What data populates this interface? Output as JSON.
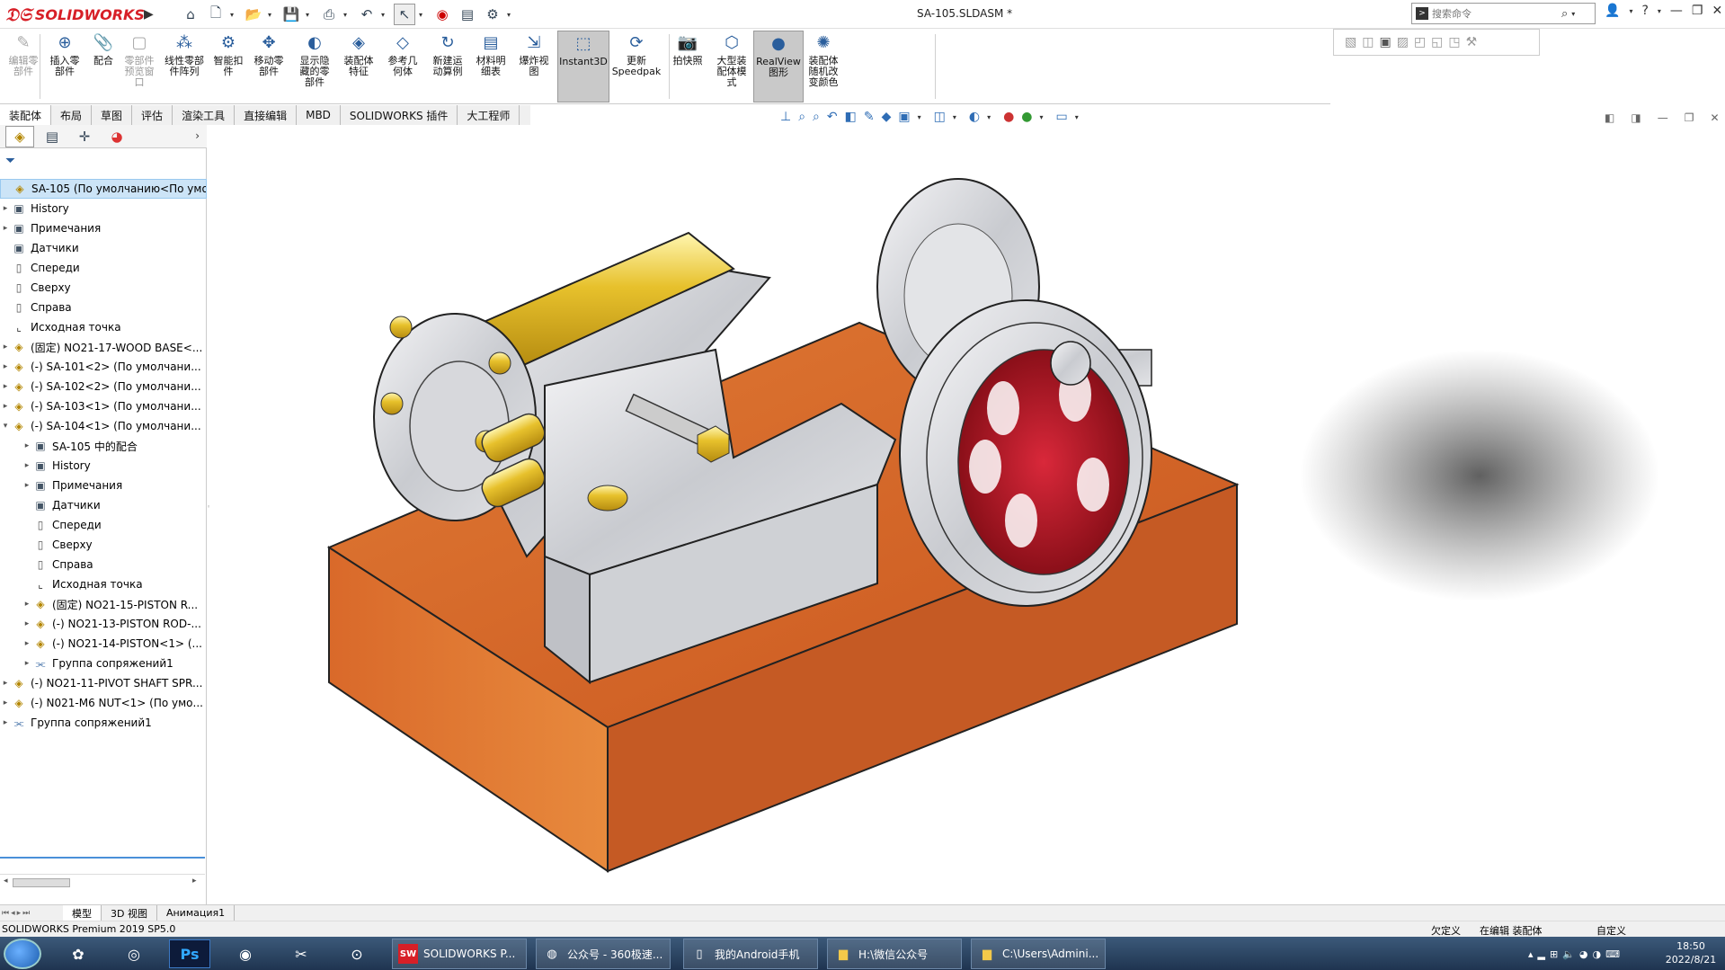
{
  "app": {
    "logo_text": "SOLIDWORKS",
    "doc_title": "SA-105.SLDASM *"
  },
  "search": {
    "placeholder": "搜索命令"
  },
  "ribbon": {
    "buttons": [
      {
        "label": "编辑零\n部件",
        "icon": "edit-component-icon",
        "disabled": true
      },
      {
        "label": "插入零\n部件",
        "icon": "insert-component-icon"
      },
      {
        "label": "配合",
        "icon": "mate-icon"
      },
      {
        "label": "零部件\n预览窗\n口",
        "icon": "component-preview-icon",
        "disabled": true
      },
      {
        "label": "线性零部\n件阵列",
        "icon": "linear-pattern-icon"
      },
      {
        "label": "智能扣\n件",
        "icon": "smart-fasteners-icon"
      },
      {
        "label": "移动零\n部件",
        "icon": "move-component-icon"
      },
      {
        "label": "显示隐\n藏的零\n部件",
        "icon": "show-hidden-icon"
      },
      {
        "label": "装配体\n特征",
        "icon": "assembly-features-icon"
      },
      {
        "label": "参考几\n何体",
        "icon": "reference-geometry-icon"
      },
      {
        "label": "新建运\n动算例",
        "icon": "new-motion-study-icon"
      },
      {
        "label": "材料明\n细表",
        "icon": "bill-of-materials-icon"
      },
      {
        "label": "爆炸视\n图",
        "icon": "exploded-view-icon"
      },
      {
        "label": "Instant3D",
        "icon": "instant3d-icon",
        "active": true
      },
      {
        "label": "更新\nSpeedpak",
        "icon": "speedpak-icon"
      },
      {
        "label": "拍快照",
        "icon": "snapshot-icon"
      },
      {
        "label": "大型装\n配体模\n式",
        "icon": "large-assembly-icon"
      },
      {
        "label": "RealView\n图形",
        "icon": "realview-icon",
        "active": true
      },
      {
        "label": "装配体\n随机改\n变颜色",
        "icon": "random-color-icon"
      }
    ]
  },
  "tabs": [
    "装配体",
    "布局",
    "草图",
    "评估",
    "渲染工具",
    "直接编辑",
    "MBD",
    "SOLIDWORKS 插件",
    "大工程师"
  ],
  "tree": {
    "rows": [
      {
        "label": "SA-105  (По умолчанию<По умо...",
        "icon": "asm",
        "indent": 0,
        "exp": "",
        "sel": true
      },
      {
        "label": "History",
        "icon": "folder",
        "indent": 0,
        "exp": "▸"
      },
      {
        "label": "Примечания",
        "icon": "folder",
        "indent": 0,
        "exp": "▸"
      },
      {
        "label": "Датчики",
        "icon": "folder",
        "indent": 0,
        "exp": ""
      },
      {
        "label": "Спереди",
        "icon": "plane",
        "indent": 0,
        "exp": ""
      },
      {
        "label": "Сверху",
        "icon": "plane",
        "indent": 0,
        "exp": ""
      },
      {
        "label": "Справа",
        "icon": "plane",
        "indent": 0,
        "exp": ""
      },
      {
        "label": "Исходная точка",
        "icon": "origin",
        "indent": 0,
        "exp": ""
      },
      {
        "label": "(固定) NO21-17-WOOD BASE<...",
        "icon": "asm",
        "indent": 0,
        "exp": "▸"
      },
      {
        "label": "(-) SA-101<2> (По умолчани...",
        "icon": "asm",
        "indent": 0,
        "exp": "▸"
      },
      {
        "label": "(-) SA-102<2> (По умолчани...",
        "icon": "asm",
        "indent": 0,
        "exp": "▸"
      },
      {
        "label": "(-) SA-103<1> (По умолчани...",
        "icon": "asm",
        "indent": 0,
        "exp": "▸"
      },
      {
        "label": "(-) SA-104<1> (По умолчани...",
        "icon": "asm",
        "indent": 0,
        "exp": "▾"
      },
      {
        "label": "SA-105 中的配合",
        "icon": "folder",
        "indent": 1,
        "exp": "▸"
      },
      {
        "label": "History",
        "icon": "folder",
        "indent": 1,
        "exp": "▸"
      },
      {
        "label": "Примечания",
        "icon": "folder",
        "indent": 1,
        "exp": "▸"
      },
      {
        "label": "Датчики",
        "icon": "folder",
        "indent": 1,
        "exp": ""
      },
      {
        "label": "Спереди",
        "icon": "plane",
        "indent": 1,
        "exp": ""
      },
      {
        "label": "Сверху",
        "icon": "plane",
        "indent": 1,
        "exp": ""
      },
      {
        "label": "Справа",
        "icon": "plane",
        "indent": 1,
        "exp": ""
      },
      {
        "label": "Исходная точка",
        "icon": "origin",
        "indent": 1,
        "exp": ""
      },
      {
        "label": "(固定) NO21-15-PISTON R...",
        "icon": "asm",
        "indent": 1,
        "exp": "▸"
      },
      {
        "label": "(-) NO21-13-PISTON ROD-...",
        "icon": "asm",
        "indent": 1,
        "exp": "▸"
      },
      {
        "label": "(-) NO21-14-PISTON<1> (...",
        "icon": "asm",
        "indent": 1,
        "exp": "▸"
      },
      {
        "label": "Группа сопряжений1",
        "icon": "mate",
        "indent": 1,
        "exp": "▸"
      },
      {
        "label": "(-) NO21-11-PIVOT SHAFT SPR...",
        "icon": "asm",
        "indent": 0,
        "exp": "▸"
      },
      {
        "label": "(-) N021-M6 NUT<1> (По умо...",
        "icon": "asm",
        "indent": 0,
        "exp": "▸"
      },
      {
        "label": "Группа сопряжений1",
        "icon": "mate",
        "indent": 0,
        "exp": "▸"
      }
    ]
  },
  "bottom_tabs": [
    "模型",
    "3D 视图",
    "Анимация1"
  ],
  "status": {
    "app": "SOLIDWORKS Premium 2019 SP5.0",
    "undefined": "欠定义",
    "editing": "在编辑 装配体",
    "custom": "自定义"
  },
  "taskbar": {
    "tasks": [
      {
        "label": "SOLIDWORKS P...",
        "icon": "solidworks-icon"
      },
      {
        "label": "公众号 - 360极速...",
        "icon": "browser-icon"
      },
      {
        "label": "我的Android手机",
        "icon": "phone-icon"
      },
      {
        "label": "H:\\微信公众号",
        "icon": "folder-icon"
      },
      {
        "label": "C:\\Users\\Admini...",
        "icon": "folder-icon"
      }
    ],
    "time": "18:50",
    "date": "2022/8/21"
  },
  "colors": {
    "brand": "#d71f27",
    "selection": "#cce4f7",
    "wood": "#d3652a",
    "brass": "#e8c22e",
    "flywheel_inner": "#a51020"
  }
}
